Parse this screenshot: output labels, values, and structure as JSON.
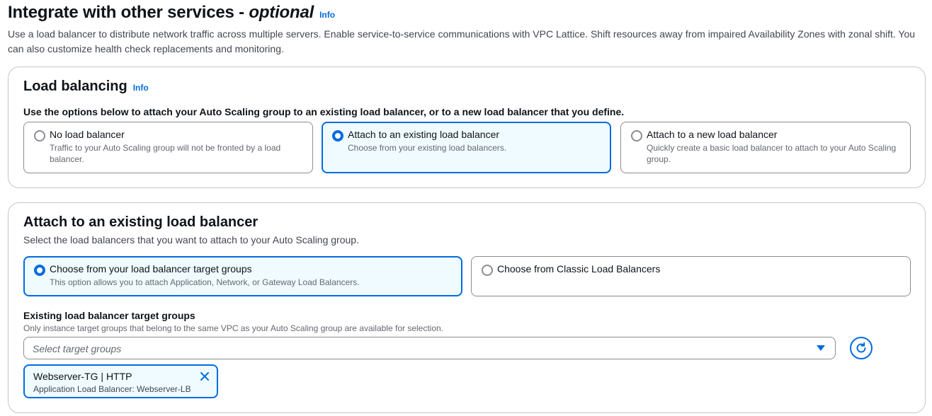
{
  "header": {
    "title": "Integrate with other services - ",
    "title_optional": "optional",
    "info": "Info",
    "description": "Use a load balancer to distribute network traffic across multiple servers. Enable service-to-service communications with VPC Lattice. Shift resources away from impaired Availability Zones with zonal shift. You can also customize health check replacements and monitoring."
  },
  "load_balancing": {
    "title": "Load balancing",
    "info": "Info",
    "instruction": "Use the options below to attach your Auto Scaling group to an existing load balancer, or to a new load balancer that you define.",
    "options": [
      {
        "label": "No load balancer",
        "description": "Traffic to your Auto Scaling group will not be fronted by a load balancer.",
        "selected": false
      },
      {
        "label": "Attach to an existing load balancer",
        "description": "Choose from your existing load balancers.",
        "selected": true
      },
      {
        "label": "Attach to a new load balancer",
        "description": "Quickly create a basic load balancer to attach to your Auto Scaling group.",
        "selected": false
      }
    ]
  },
  "attach_existing": {
    "title": "Attach to an existing load balancer",
    "description": "Select the load balancers that you want to attach to your Auto Scaling group.",
    "options": [
      {
        "label": "Choose from your load balancer target groups",
        "description": "This option allows you to attach Application, Network, or Gateway Load Balancers.",
        "selected": true
      },
      {
        "label": "Choose from Classic Load Balancers",
        "description": "",
        "selected": false
      }
    ],
    "target_groups": {
      "label": "Existing load balancer target groups",
      "hint": "Only instance target groups that belong to the same VPC as your Auto Scaling group are available for selection.",
      "placeholder": "Select target groups",
      "selected_token": {
        "title": "Webserver-TG | HTTP",
        "description": "Application Load Balancer: Webserver-LB"
      }
    }
  },
  "icons": {
    "refresh": "refresh-icon",
    "dropdown": "caret-down-icon",
    "dismiss": "close-icon"
  },
  "colors": {
    "accent": "#006ce0",
    "selected_bg": "#f0fbff",
    "border": "#8c8c94",
    "text": "#0f141a",
    "secondary_text": "#656871"
  }
}
